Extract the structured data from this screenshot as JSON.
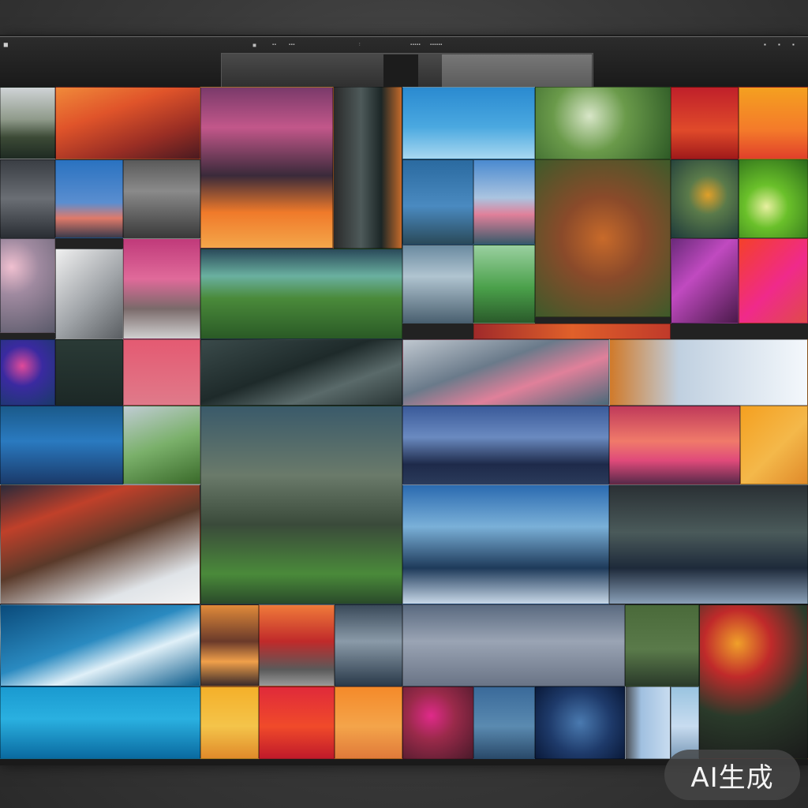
{
  "toolbar": {
    "menu_items": [
      "◼",
      "▪▪",
      "▪▪▪",
      "⫶",
      "▪▪▪▪▪",
      "▪▪▪▪▪▪"
    ]
  },
  "watermark": {
    "label": "AI生成"
  },
  "tiles": [
    {
      "name": "tile-mountain-pale",
      "bg": "linear-gradient(180deg,#cfd3d6 0%,#8f9a8a 45%,#3c4a36 70%,#1e2a22 100%)"
    },
    {
      "name": "tile-orange-field",
      "bg": "linear-gradient(160deg,#f08a3a 0%,#e0542a 35%,#9a2e24 70%,#4a1a20 100%)"
    },
    {
      "name": "tile-forest-roots",
      "bg": "linear-gradient(180deg,#7a3a6a 0%,#c2578a 25%,#3a2a3a 55%,#f07a2a 78%,#f4a64a 100%)"
    },
    {
      "name": "tile-dark-trunks",
      "bg": "linear-gradient(90deg,#2a2a2a 0%,#4e5a5a 40%,#1c2626 70%,#c46a2a 100%)"
    },
    {
      "name": "tile-blue-sky",
      "bg": "linear-gradient(180deg,#2a8ad0 0%,#4aa8e0 55%,#a8d8f0 100%)"
    },
    {
      "name": "tile-green-leaves",
      "bg": "radial-gradient(circle at 40% 40%,#d8e6c8 0%,#6a9a4a 40%,#2e5a26 100%)"
    },
    {
      "name": "tile-red-glow",
      "bg": "linear-gradient(180deg,#c0202a 0%,#e04a2a 60%,#a01a1a 100%)"
    },
    {
      "name": "tile-orange-sunset",
      "bg": "linear-gradient(180deg,#f4a020 0%,#f47a2a 60%,#e0402a 100%)"
    },
    {
      "name": "tile-ink-landscape",
      "bg": "linear-gradient(180deg,#3a3e44 0%,#6a6e74 50%,#2a2e34 100%)"
    },
    {
      "name": "tile-blue-dusk",
      "bg": "linear-gradient(180deg,#2a72c0 0%,#5a8ed0 55%,#e07a6a 75%,#3a3a4a 100%)"
    },
    {
      "name": "tile-grey-hills",
      "bg": "linear-gradient(180deg,#5a5a5a 0%,#8a8a8a 40%,#3a3a3a 100%)"
    },
    {
      "name": "tile-pine-coast",
      "bg": "linear-gradient(180deg,#2a6aa0 0%,#4a8ac0 55%,#2a4a5a 100%)"
    },
    {
      "name": "tile-pink-horizon",
      "bg": "linear-gradient(180deg,#4a8ad0 0%,#aac4e0 45%,#e0809a 65%,#3a5a6a 100%)"
    },
    {
      "name": "tile-red-foliage",
      "bg": "radial-gradient(circle at 50% 50%,#c86a2a 0%,#8a4a2a 40%,#3e5a2a 100%)"
    },
    {
      "name": "tile-teal-cloud",
      "bg": "radial-gradient(circle at 55% 45%,#e0a02a 0%,#5a7a4a 35%,#1e3a3a 100%)"
    },
    {
      "name": "tile-green-flare",
      "bg": "radial-gradient(circle at 40% 60%,#e8f0a0 0%,#6ac02a 35%,#2a6a1a 100%)"
    },
    {
      "name": "tile-violet-floral",
      "bg": "linear-gradient(135deg,#6a2a7a 0%,#c04ac0 40%,#4a1a4a 100%)"
    },
    {
      "name": "tile-magenta-blossom",
      "bg": "linear-gradient(135deg,#f4402a 0%,#f02a8a 55%,#e04a4a 100%)"
    },
    {
      "name": "tile-pink-fog",
      "bg": "radial-gradient(circle at 20% 30%,#f0c0d0 0%,#a08aa0 35%,#5a5a6a 100%)"
    },
    {
      "name": "tile-grey-gradient",
      "bg": "linear-gradient(135deg,#f0f0f0 0%,#a0a4a8 55%,#5a5e62 100%)"
    },
    {
      "name": "tile-pink-reeds",
      "bg": "linear-gradient(180deg,#c03a7a 0%,#e06a9a 40%,#7a6a6a 70%,#d0d0d0 100%)"
    },
    {
      "name": "tile-green-hill",
      "bg": "linear-gradient(180deg,#2a4a5a 0%,#6ab0a0 30%,#4a8a3a 55%,#2a5a26 100%)"
    },
    {
      "name": "tile-stream-rocks",
      "bg": "linear-gradient(180deg,#6a8aa0 0%,#b0c4d0 40%,#4a6070 100%)"
    },
    {
      "name": "tile-meadow",
      "bg": "linear-gradient(180deg,#9ad0a0 0%,#4aa04a 55%,#2a5a2a 100%)"
    },
    {
      "name": "tile-red-bar",
      "bg": "linear-gradient(90deg,#a02a2a 0%,#e0602a 50%,#c03a2a 100%)"
    },
    {
      "name": "tile-blue-swirl",
      "bg": "radial-gradient(circle at 40% 40%,#e04a9a 0%,#3a2aa0 40%,#1a3a6a 100%)"
    },
    {
      "name": "tile-dark-green",
      "bg": "linear-gradient(180deg,#2a3a36 0%,#1c2826 100%)"
    },
    {
      "name": "tile-rose",
      "bg": "linear-gradient(180deg,#e45a72 0%,#e07a8a 100%)"
    },
    {
      "name": "tile-dark-wave",
      "bg": "linear-gradient(160deg,#3a4a4a 0%,#1e2a2a 45%,#5a6a6a 70%,#2a3636 100%)"
    },
    {
      "name": "tile-cloud-streak",
      "bg": "linear-gradient(160deg,#c0c8d0 0%,#6a7a8a 40%,#e0809a 65%,#4a6a7a 100%)"
    },
    {
      "name": "tile-amber-white",
      "bg": "linear-gradient(90deg,#d07a2a 0%,#c0d0e0 35%,#f4f8fc 100%)"
    },
    {
      "name": "tile-teal-dunes",
      "bg": "linear-gradient(180deg,#1a5a8a 0%,#2a7ac0 45%,#1a3a6a 100%)"
    },
    {
      "name": "tile-green-slope",
      "bg": "linear-gradient(160deg,#c0ccd4 0%,#7ab06a 50%,#3a6a2a 100%)"
    },
    {
      "name": "tile-ruined-building",
      "bg": "linear-gradient(180deg,#3a5a6a 0%,#6a7a6a 35%,#3a4a3a 60%,#4a8a3a 85%,#2a4a2a 100%)"
    },
    {
      "name": "tile-snowy-ridge",
      "bg": "linear-gradient(180deg,#3a5a9a 0%,#6a8ac0 40%,#1e2a4a 75%,#2a3a5a 100%)"
    },
    {
      "name": "tile-coral-sunset",
      "bg": "linear-gradient(180deg,#c03a5a 0%,#f07a6a 45%,#e04a7a 70%,#5a2a4a 100%)"
    },
    {
      "name": "tile-golden-arc",
      "bg": "linear-gradient(135deg,#f4a020 0%,#f4b84a 55%,#e08a2a 100%)"
    },
    {
      "name": "tile-motion-blur",
      "bg": "linear-gradient(160deg,#2a2a3a 0%,#c0402a 25%,#5a3a2a 50%,#e0e4e8 80%,#f4f4f4 100%)"
    },
    {
      "name": "tile-snow-mountains",
      "bg": "linear-gradient(180deg,#2a6ab0 0%,#7ab0d8 35%,#1e3a5a 70%,#c8d8e8 100%)"
    },
    {
      "name": "tile-night-peaks",
      "bg": "linear-gradient(180deg,#2a3034 0%,#4a5a5a 40%,#1e2a3a 70%,#8aa0b8 100%)"
    },
    {
      "name": "tile-blue-wave",
      "bg": "linear-gradient(160deg,#0a4a7a 0%,#2a8ac0 45%,#e0f0f8 65%,#0a5a8a 100%)"
    },
    {
      "name": "tile-copper-dunes",
      "bg": "linear-gradient(180deg,#e08a3a 0%,#6a3a2a 45%,#f0a04a 70%,#3a2a2a 100%)"
    },
    {
      "name": "tile-red-peak",
      "bg": "linear-gradient(180deg,#f07a3a 0%,#c02a2a 45%,#5a5a5a 80%,#9a9a9a 100%)"
    },
    {
      "name": "tile-steel-flow",
      "bg": "linear-gradient(180deg,#3a4a5a 0%,#8a9aa8 45%,#2a3a4a 100%)"
    },
    {
      "name": "tile-overcast",
      "bg": "linear-gradient(180deg,#5a6a80 0%,#9aa4b4 45%,#6a7486 100%)"
    },
    {
      "name": "tile-olive-haze",
      "bg": "linear-gradient(180deg,#4a6a3a 0%,#5a7a4a 55%,#2a3a2a 100%)"
    },
    {
      "name": "tile-autumn-burst",
      "bg": "radial-gradient(circle at 35% 25%,#f0a02a 0%,#c02a2a 25%,#2a3a2a 55%,#1a1a1a 100%)"
    },
    {
      "name": "tile-cyan-ocean",
      "bg": "linear-gradient(180deg,#1a9ad0 0%,#2ab0e0 45%,#0a6aa0 100%)"
    },
    {
      "name": "tile-yellow-glow",
      "bg": "linear-gradient(180deg,#f4b02a 0%,#f4c44a 55%,#e08a2a 100%)"
    },
    {
      "name": "tile-crimson",
      "bg": "linear-gradient(180deg,#e02a3a 0%,#f04a2a 55%,#c01a2a 100%)"
    },
    {
      "name": "tile-peach",
      "bg": "linear-gradient(180deg,#f48a2a 0%,#f4a44a 55%,#e07a3a 100%)"
    },
    {
      "name": "tile-berry-texture",
      "bg": "radial-gradient(circle at 40% 40%,#e02a8a 0%,#9a2a4a 40%,#4a1a2a 100%)"
    },
    {
      "name": "tile-slate-blue",
      "bg": "linear-gradient(180deg,#3a6a9a 0%,#5a8ab0 55%,#2a4a6a 100%)"
    },
    {
      "name": "tile-dotted-navy",
      "bg": "radial-gradient(circle at 50% 50%,#4a7ab0 0%,#1e3a6a 55%,#0a1a3a 100%)"
    },
    {
      "name": "tile-pale-window",
      "bg": "linear-gradient(90deg,#4a4e54 0%,#a0c0e0 35%,#c8dcf0 100%)"
    },
    {
      "name": "tile-misty-sky",
      "bg": "linear-gradient(180deg,#9ac4e0 0%,#c8dcf0 55%,#7a9ab8 100%)"
    }
  ]
}
